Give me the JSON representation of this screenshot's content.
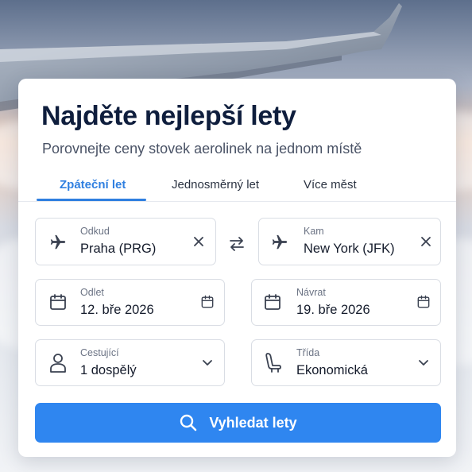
{
  "hero": {
    "title": "Najděte nejlepší lety",
    "subtitle": "Porovnejte ceny stovek aerolinek na jednom místě"
  },
  "tabs": [
    {
      "label": "Zpáteční let",
      "active": true
    },
    {
      "label": "Jednosměrný let",
      "active": false
    },
    {
      "label": "Více měst",
      "active": false
    }
  ],
  "form": {
    "from": {
      "label": "Odkud",
      "value": "Praha (PRG)",
      "icon": "plane-icon",
      "action_icon": "clear-icon"
    },
    "to": {
      "label": "Kam",
      "value": "New York (JFK)",
      "icon": "plane-icon",
      "action_icon": "clear-icon"
    },
    "swap_icon": "swap-icon",
    "departure": {
      "label": "Odlet",
      "value": "12. bře 2026",
      "icon": "calendar-icon"
    },
    "return": {
      "label": "Návrat",
      "value": "19. bře 2026",
      "icon": "calendar-icon"
    },
    "passengers": {
      "label": "Cestující",
      "value": "1 dospělý",
      "icon": "person-icon",
      "action_icon": "chevron-down-icon"
    },
    "cabin_class": {
      "label": "Třída",
      "value": "Ekonomická",
      "icon": "seat-icon",
      "action_icon": "chevron-down-icon"
    }
  },
  "search_button": {
    "label": "Vyhledat lety",
    "icon": "search-icon"
  },
  "colors": {
    "accent": "#2f86f0",
    "title": "#0f1e3d",
    "tab_active": "#2f7fe0"
  }
}
